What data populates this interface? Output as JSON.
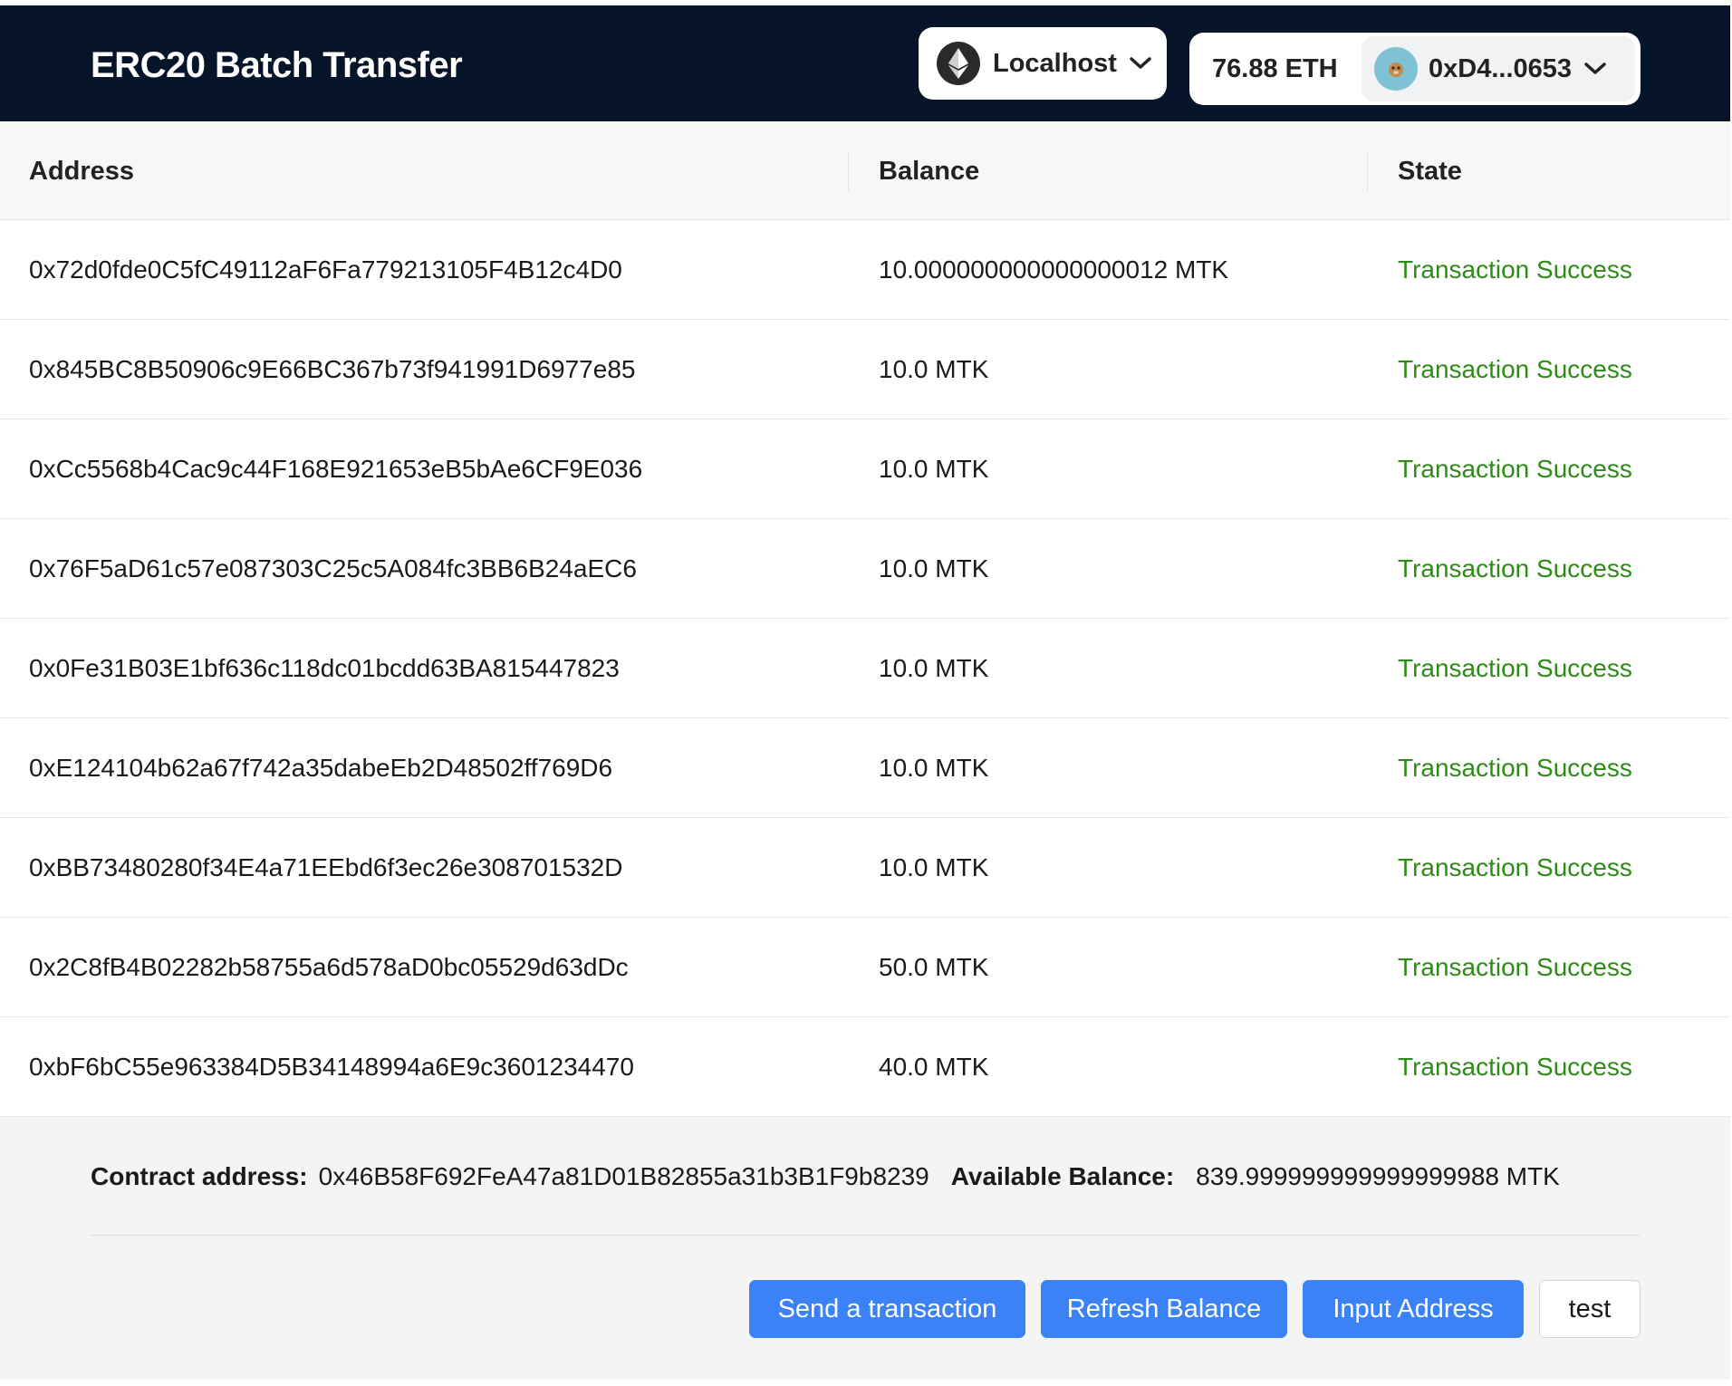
{
  "header": {
    "title": "ERC20 Batch Transfer",
    "network": {
      "label": "Localhost",
      "icon": "ethereum-icon"
    },
    "account": {
      "eth_balance": "76.88 ETH",
      "address_short": "0xD4...0653",
      "avatar_icon": "avatar-icon"
    }
  },
  "table": {
    "columns": [
      "Address",
      "Balance",
      "State"
    ],
    "rows": [
      {
        "address": "0x72d0fde0C5fC49112aF6Fa779213105F4B12c4D0",
        "balance": "10.000000000000000012 MTK",
        "state": "Transaction Success"
      },
      {
        "address": "0x845BC8B50906c9E66BC367b73f941991D6977e85",
        "balance": "10.0 MTK",
        "state": "Transaction Success"
      },
      {
        "address": "0xCc5568b4Cac9c44F168E921653eB5bAe6CF9E036",
        "balance": "10.0 MTK",
        "state": "Transaction Success"
      },
      {
        "address": "0x76F5aD61c57e087303C25c5A084fc3BB6B24aEC6",
        "balance": "10.0 MTK",
        "state": "Transaction Success"
      },
      {
        "address": "0x0Fe31B03E1bf636c118dc01bcdd63BA815447823",
        "balance": "10.0 MTK",
        "state": "Transaction Success"
      },
      {
        "address": "0xE124104b62a67f742a35dabeEb2D48502ff769D6",
        "balance": "10.0 MTK",
        "state": "Transaction Success"
      },
      {
        "address": "0xBB73480280f34E4a71EEbd6f3ec26e308701532D",
        "balance": "10.0 MTK",
        "state": "Transaction Success"
      },
      {
        "address": "0x2C8fB4B02282b58755a6d578aD0bc05529d63dDc",
        "balance": "50.0 MTK",
        "state": "Transaction Success"
      },
      {
        "address": "0xbF6bC55e963384D5B34148994a6E9c3601234470",
        "balance": "40.0 MTK",
        "state": "Transaction Success"
      }
    ]
  },
  "footer": {
    "contract_label": "Contract address:",
    "contract_address": "0x46B58F692FeA47a81D01B82855a31b3B1F9b8239",
    "available_label": "Available Balance:",
    "available_balance": "839.999999999999999988 MTK",
    "buttons": {
      "send": "Send a transaction",
      "refresh": "Refresh Balance",
      "input": "Input Address",
      "test": "test"
    }
  },
  "colors": {
    "header_bg": "#061529",
    "success": "#2e8b17",
    "primary": "#3b82f6"
  }
}
